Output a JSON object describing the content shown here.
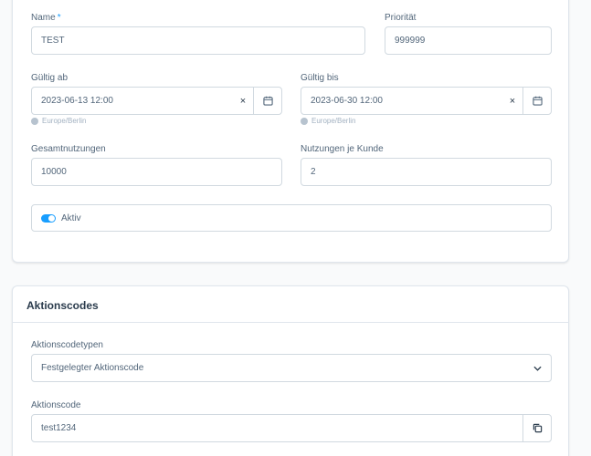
{
  "general": {
    "name_label": "Name",
    "name_required_mark": "*",
    "name_value": "TEST",
    "priority_label": "Priorität",
    "priority_value": "999999",
    "valid_from_label": "Gültig ab",
    "valid_from_value": "2023-06-13 12:00",
    "valid_from_timezone": "Europe/Berlin",
    "valid_until_label": "Gültig bis",
    "valid_until_value": "2023-06-30 12:00",
    "valid_until_timezone": "Europe/Berlin",
    "clear_glyph": "×",
    "total_uses_label": "Gesamtnutzungen",
    "total_uses_value": "10000",
    "uses_per_customer_label": "Nutzungen je Kunde",
    "uses_per_customer_value": "2",
    "active_label": "Aktiv",
    "active_on": true
  },
  "promo_codes": {
    "title": "Aktionscodes",
    "type_label": "Aktionscodetypen",
    "type_value": "Festgelegter Aktionscode",
    "code_label": "Aktionscode",
    "code_value": "test1234"
  },
  "colors": {
    "accent": "#189eff",
    "text": "#52667a",
    "heading": "#2a3b4c",
    "border": "#d1d9e0",
    "background": "#f9fafb"
  },
  "icons": {
    "calendar": "calendar-icon",
    "clear": "close-icon",
    "timezone": "globe-icon",
    "chevron": "chevron-down-icon",
    "copy": "copy-icon"
  }
}
